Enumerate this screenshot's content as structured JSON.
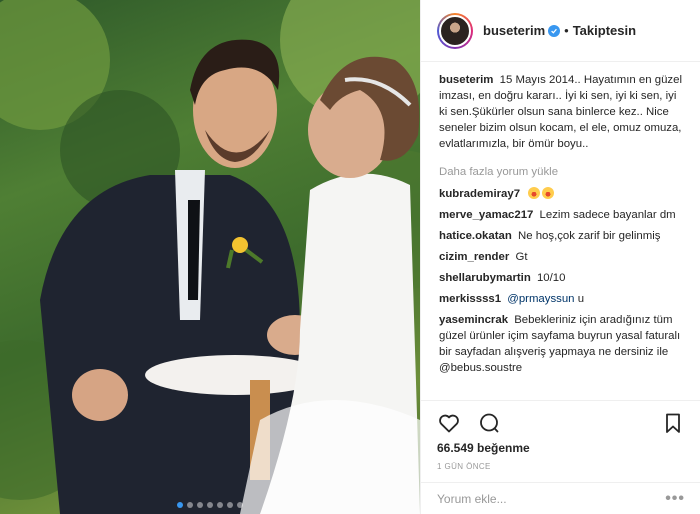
{
  "post": {
    "image_alt": "Wedding photo of a couple at a table",
    "carousel_dots": 7
  },
  "header": {
    "username": "buseterim",
    "separator": "•",
    "follow_label": "Takiptesin"
  },
  "caption": {
    "username": "buseterim",
    "text": "15 Mayıs 2014.. Hayatımın en güzel imzası, en doğru kararı.. İyi ki sen, iyi ki sen, iyi ki sen.Şükürler olsun sana binlerce kez.. Nice seneler bizim olsun kocam, el ele, omuz omuza, evlatlarımızla, bir ömür boyu.."
  },
  "load_more": "Daha fazla yorum yükle",
  "comments": [
    {
      "user": "kubrademiray7",
      "text": "",
      "emoji_count": 2
    },
    {
      "user": "merve_yamac217",
      "text": "Lezim sadece bayanlar dm"
    },
    {
      "user": "hatice.okatan",
      "text": "Ne hoş,çok zarif bir gelinmiş"
    },
    {
      "user": "cizim_render",
      "text": "Gt"
    },
    {
      "user": "shellarubymartin",
      "text": "10/10"
    },
    {
      "user": "merkissss1",
      "mention": "@prmayssun",
      "text": " u"
    },
    {
      "user": "yasemincrak",
      "text": "Bebekleriniz için aradığınız tüm güzel ürünler içim sayfama buyrun yasal faturalı bir sayfadan alışveriş yapmaya ne dersiniz ile @bebus.soustre"
    }
  ],
  "actions": {
    "likes": "66.549 beğenme",
    "time": "1 GÜN ÖNCE"
  },
  "add_comment": {
    "placeholder": "Yorum ekle...",
    "more": "•••"
  },
  "colors": {
    "accent": "#3897f0",
    "text": "#262626",
    "muted": "#999999",
    "mention": "#003569"
  }
}
